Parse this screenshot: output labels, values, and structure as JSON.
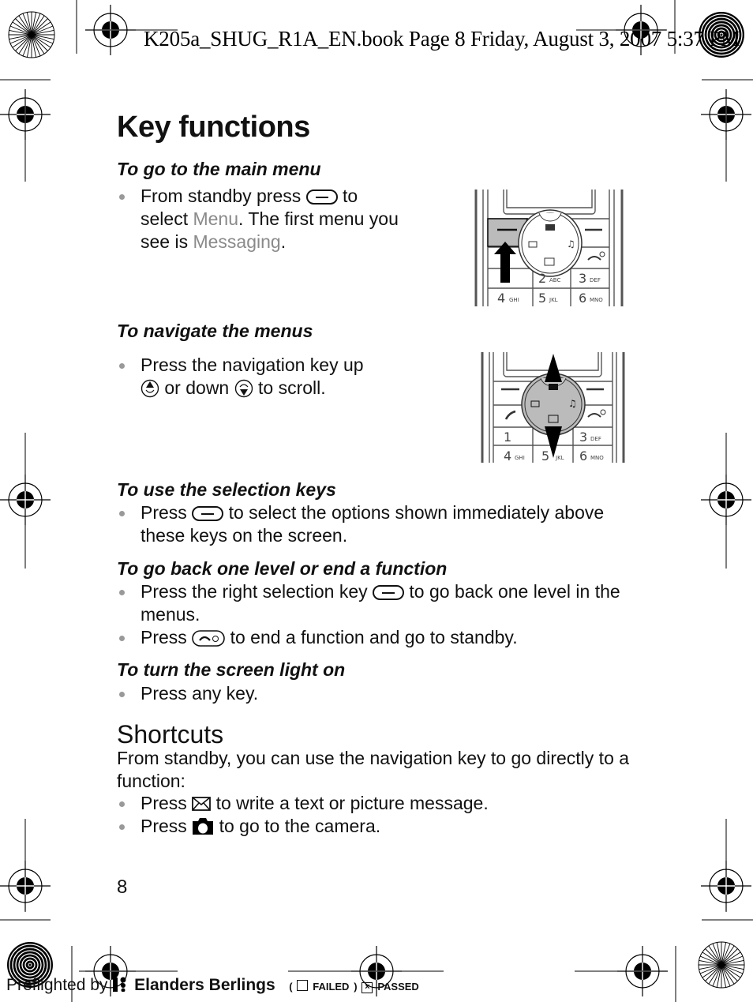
{
  "header": {
    "running_head": "K205a_SHUG_R1A_EN.book  Page 8  Friday, August 3, 2007  5:37 PM"
  },
  "title": "Key functions",
  "sections": [
    {
      "heading": "To go to the main menu",
      "bullets": [
        {
          "before": "From standby press",
          "icon": "left-selection-key-icon",
          "after": "to select",
          "highlight1": "Menu",
          "mid": ". The first menu you see is",
          "highlight2": "Messaging",
          "end": "."
        }
      ]
    },
    {
      "heading": "To navigate the menus",
      "bullets": [
        {
          "line1": "Press the navigation key up",
          "mid": "or down",
          "end": "to scroll."
        }
      ]
    },
    {
      "heading": "To use the selection keys",
      "bullets": [
        {
          "before": "Press",
          "after": "to select the options shown immediately above these keys on the screen."
        }
      ]
    },
    {
      "heading": "To go back one level or end a function",
      "bullets": [
        {
          "before": "Press the right selection key",
          "after": "to go back one level in the menus."
        },
        {
          "before": "Press",
          "after": "to end a function and go to standby."
        }
      ]
    },
    {
      "heading": "To turn the screen light on",
      "bullets": [
        {
          "text": "Press any key."
        }
      ]
    }
  ],
  "shortcuts": {
    "heading": "Shortcuts",
    "intro": "From standby, you can use the navigation key to go directly to a function:",
    "bullets": [
      {
        "before": "Press",
        "icon": "envelope-icon",
        "after": "to write a text or picture message."
      },
      {
        "before": "Press",
        "icon": "camera-icon",
        "after": "to go to the camera."
      }
    ]
  },
  "phone_illustrations": {
    "keypad_labels": [
      "1",
      "2 ABC",
      "3 DEF",
      "4 GHI",
      "5 JKL",
      "6 MNO"
    ],
    "key2": "ABC",
    "key3": "DEF",
    "key4": "GHI",
    "key5": "JKL",
    "key6": "MNO"
  },
  "page_number": "8",
  "footer": {
    "preflighted_by": "Preflighted by",
    "brand": "Elanders Berlings",
    "failed_label": "FAILED",
    "passed_label": "PASSED",
    "status": "passed"
  }
}
